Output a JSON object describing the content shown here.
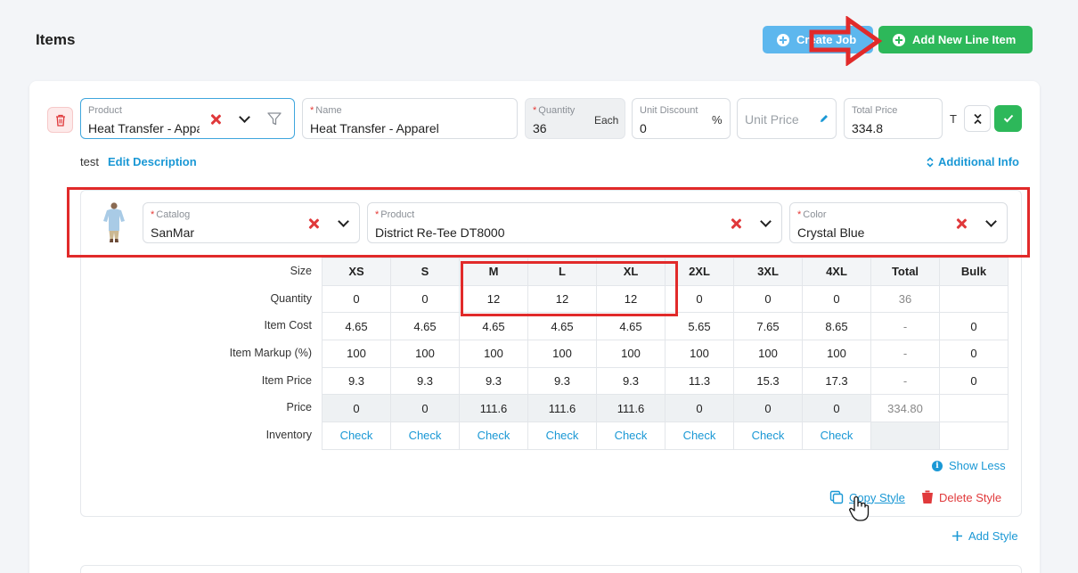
{
  "header": {
    "title": "Items",
    "create_job": "Create Job",
    "add_line_item": "Add New Line Item"
  },
  "line_item": {
    "product": {
      "label": "Product",
      "value": "Heat Transfer - Appa"
    },
    "name": {
      "label": "Name",
      "value": "Heat Transfer - Apparel"
    },
    "quantity": {
      "label": "Quantity",
      "value": "36",
      "unit": "Each"
    },
    "unit_discount": {
      "label": "Unit Discount",
      "value": "0",
      "unit": "%"
    },
    "unit_price": {
      "placeholder": "Unit Price"
    },
    "total_price": {
      "label": "Total Price",
      "value": "334.8"
    },
    "t_label": "T",
    "description": "test",
    "edit_description": "Edit Description",
    "additional_info": "Additional Info"
  },
  "style": {
    "catalog": {
      "label": "Catalog",
      "value": "SanMar"
    },
    "product": {
      "label": "Product",
      "value": "District Re-Tee DT8000"
    },
    "color": {
      "label": "Color",
      "value": "Crystal Blue"
    },
    "row_labels": [
      "Size",
      "Quantity",
      "Item Cost",
      "Item Markup (%)",
      "Item Price",
      "Price",
      "Inventory"
    ],
    "sizes": [
      "XS",
      "S",
      "M",
      "L",
      "XL",
      "2XL",
      "3XL",
      "4XL"
    ],
    "total_header": "Total",
    "bulk_header": "Bulk",
    "quantity": [
      "0",
      "0",
      "12",
      "12",
      "12",
      "0",
      "0",
      "0"
    ],
    "quantity_total": "36",
    "item_cost": [
      "4.65",
      "4.65",
      "4.65",
      "4.65",
      "4.65",
      "5.65",
      "7.65",
      "8.65"
    ],
    "item_cost_total": "-",
    "item_cost_bulk": "0",
    "markup": [
      "100",
      "100",
      "100",
      "100",
      "100",
      "100",
      "100",
      "100"
    ],
    "markup_total": "-",
    "markup_bulk": "0",
    "item_price": [
      "9.3",
      "9.3",
      "9.3",
      "9.3",
      "9.3",
      "11.3",
      "15.3",
      "17.3"
    ],
    "item_price_total": "-",
    "item_price_bulk": "0",
    "price": [
      "0",
      "0",
      "111.6",
      "111.6",
      "111.6",
      "0",
      "0",
      "0"
    ],
    "price_total": "334.80",
    "inventory_label": "Check",
    "show_less": "Show Less",
    "copy_style": "Copy Style",
    "delete_style": "Delete Style",
    "add_style": "Add Style"
  },
  "colors": {
    "accent_blue": "#1a98d5",
    "green": "#2db85a",
    "light_blue": "#5db7ee",
    "red": "#e0393b",
    "annotation_red": "#e12a2a"
  }
}
